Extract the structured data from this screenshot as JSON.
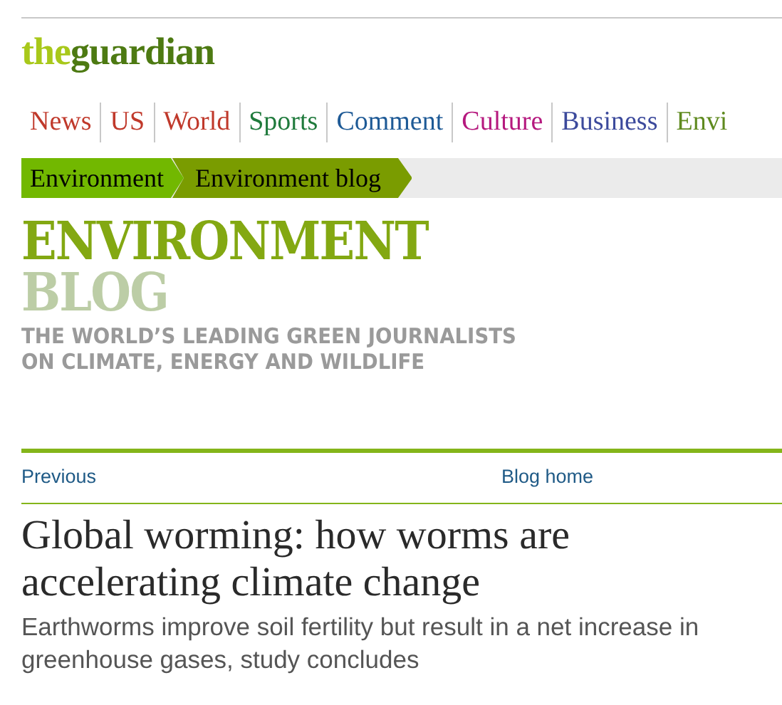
{
  "logo": {
    "prefix": "the",
    "name": "guardian"
  },
  "nav": [
    {
      "label": "News",
      "color": "#c0392b"
    },
    {
      "label": "US",
      "color": "#c0392b"
    },
    {
      "label": "World",
      "color": "#c0392b"
    },
    {
      "label": "Sports",
      "color": "#1f7a3c"
    },
    {
      "label": "Comment",
      "color": "#1e5a96"
    },
    {
      "label": "Culture",
      "color": "#b5187e"
    },
    {
      "label": "Business",
      "color": "#3c4a9c"
    },
    {
      "label": "Envi",
      "color": "#5f8a1f"
    }
  ],
  "breadcrumbs": [
    {
      "label": "Environment",
      "selected": false
    },
    {
      "label": "Environment blog",
      "selected": true
    }
  ],
  "banner": {
    "title": "ENVIRONMENT",
    "subtitle": "BLOG",
    "tagline": [
      "THE WORLD’S LEADING GREEN JOURNALISTS",
      "ON CLIMATE, ENERGY AND WILDLIFE"
    ]
  },
  "links": {
    "previous": "Previous",
    "home": "Blog home"
  },
  "article": {
    "headline": "Global worming: how worms are accelerating climate change",
    "standfirst": "Earthworms improve soil fertility but result in a net increase in greenhouse gases, study concludes"
  }
}
